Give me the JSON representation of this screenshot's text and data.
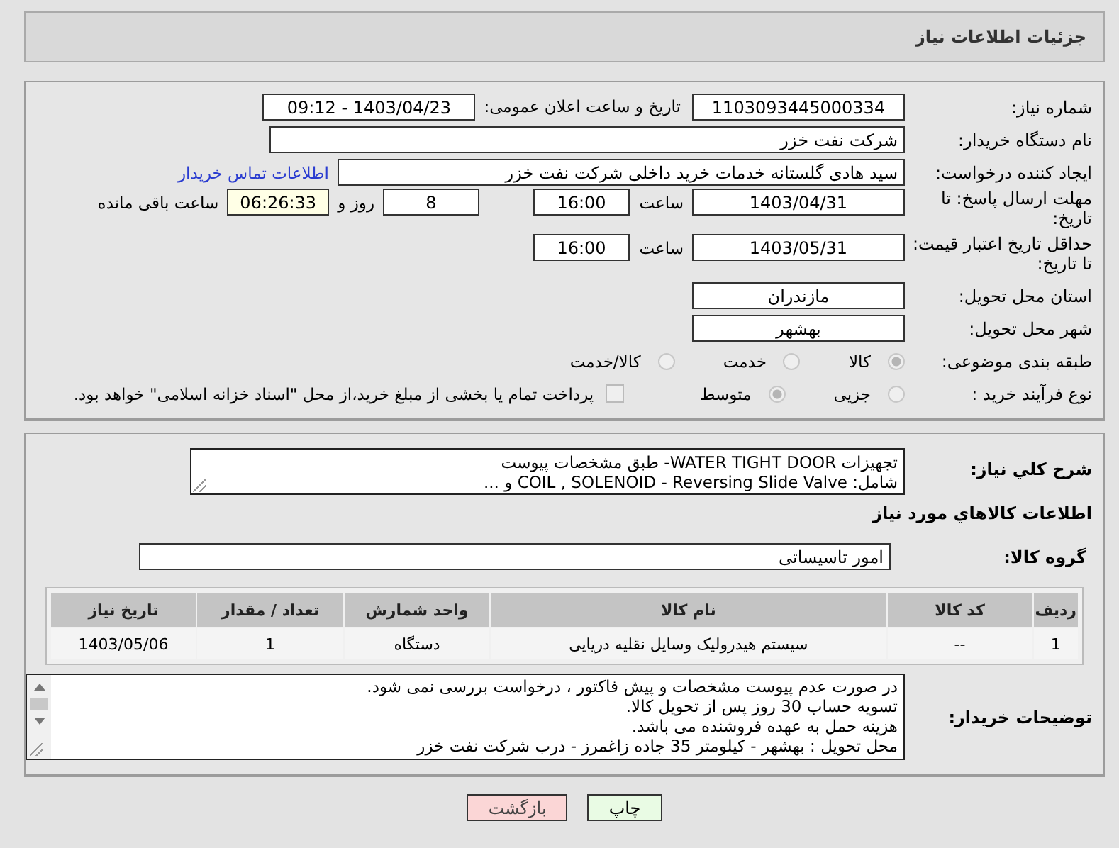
{
  "header": {
    "title": "جزئیات اطلاعات نیاز"
  },
  "form": {
    "need_number": {
      "label": "شماره نیاز:",
      "value": "1103093445000334"
    },
    "announce": {
      "label": "تاریخ و ساعت اعلان عمومی:",
      "value": "1403/04/23 - 09:12"
    },
    "buyer": {
      "label": "نام دستگاه خریدار:",
      "value": "شرکت نفت خزر"
    },
    "creator": {
      "label": "ایجاد کننده درخواست:",
      "value": "سید هادی گلستانه خدمات خرید داخلی شرکت نفت خزر",
      "link": "اطلاعات تماس خریدار"
    },
    "deadline": {
      "label": "مهلت ارسال پاسخ: تا تاریخ:",
      "date": "1403/04/31",
      "time_label": "ساعت",
      "time": "16:00",
      "days": "8",
      "days_label": "روز و",
      "remaining": "06:26:33",
      "remaining_label": "ساعت باقی مانده"
    },
    "validity": {
      "label": "حداقل تاریخ اعتبار قیمت: تا تاریخ:",
      "date": "1403/05/31",
      "time_label": "ساعت",
      "time": "16:00"
    },
    "province": {
      "label": "استان محل تحویل:",
      "value": "مازندران"
    },
    "city": {
      "label": "شهر محل تحویل:",
      "value": "بهشهر"
    },
    "category": {
      "label": "طبقه بندی موضوعی:",
      "options": [
        {
          "label": "کالا",
          "selected": true
        },
        {
          "label": "خدمت",
          "selected": false
        },
        {
          "label": "کالا/خدمت",
          "selected": false
        }
      ]
    },
    "process": {
      "label": "نوع فرآیند خرید :",
      "options": [
        {
          "label": "جزیی",
          "selected": false
        },
        {
          "label": "متوسط",
          "selected": true
        }
      ],
      "payment_checkbox": {
        "checked": false,
        "text": "پرداخت تمام یا بخشی از مبلغ خرید،از محل \"اسناد خزانه اسلامی\" خواهد بود."
      }
    }
  },
  "details": {
    "description": {
      "label": "شرح کلي نياز:",
      "lines": [
        "تجهیزات WATER TIGHT DOOR- طبق مشخصات پیوست",
        "شامل: COIL , SOLENOID - Reversing Slide Valve و ..."
      ]
    },
    "section_title": "اطلاعات کالاهاي مورد نياز",
    "goods_group": {
      "label": "گروه کالا:",
      "value": "امور تاسیساتی"
    },
    "table": {
      "columns": [
        "ردیف",
        "کد کالا",
        "نام کالا",
        "واحد شمارش",
        "تعداد / مقدار",
        "تاریخ نیاز"
      ],
      "rows": [
        [
          "1",
          "--",
          "سیستم هیدرولیک وسایل نقلیه دریایی",
          "دستگاه",
          "1",
          "1403/05/06"
        ]
      ]
    },
    "buyer_notes": {
      "label": "توضیحات خریدار:",
      "lines": [
        "در صورت عدم پیوست مشخصات و پیش فاکتور ، درخواست بررسی نمی شود.",
        "تسویه حساب 30 روز پس از تحویل کالا.",
        "هزینه حمل به عهده فروشنده می باشد.",
        "محل تحویل : بهشهر - کیلومتر 35 جاده زاغمرز - درب شرکت نفت خزر"
      ]
    }
  },
  "buttons": [
    {
      "kind": "print",
      "label": "چاپ"
    },
    {
      "kind": "back",
      "label": "بازگشت"
    }
  ]
}
